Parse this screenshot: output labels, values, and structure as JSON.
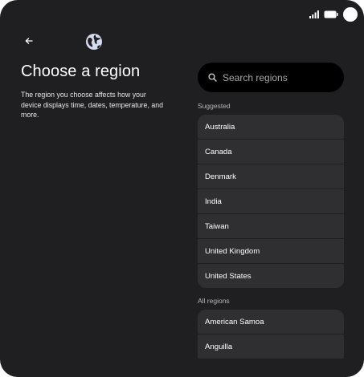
{
  "icons": {
    "signal": "signal-icon",
    "battery": "battery-icon",
    "back": "back-arrow-icon",
    "globe": "globe-icon",
    "search": "search-icon"
  },
  "colors": {
    "background": "#1f1f21",
    "list_item": "#2f2f32",
    "search_bar": "#000000",
    "text_primary": "#ffffff",
    "text_secondary": "#b5b5b8"
  },
  "header": {
    "title": "Choose a region",
    "description": "The region you choose affects how your device displays time, dates, temperature, and more."
  },
  "search": {
    "placeholder": "Search regions",
    "value": ""
  },
  "suggested": {
    "label": "Suggested",
    "items": [
      {
        "label": "Australia"
      },
      {
        "label": "Canada"
      },
      {
        "label": "Denmark"
      },
      {
        "label": "India"
      },
      {
        "label": "Taiwan"
      },
      {
        "label": "United Kingdom"
      },
      {
        "label": "United States"
      }
    ]
  },
  "all_regions": {
    "label": "All regions",
    "items": [
      {
        "label": "American Samoa"
      },
      {
        "label": "Anguilla"
      }
    ]
  }
}
